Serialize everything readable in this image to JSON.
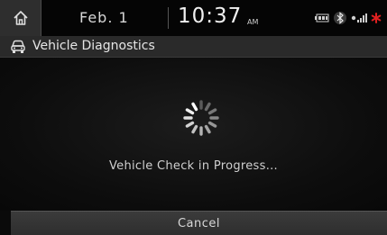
{
  "status_bar": {
    "date": "Feb. 1",
    "time": "10:37",
    "ampm": "AM",
    "icons": [
      "battery-icon",
      "bluetooth-icon",
      "signal-icon",
      "asterisk-icon"
    ],
    "accent_color": "#e02020"
  },
  "title_bar": {
    "icon": "car-icon",
    "title": "Vehicle Diagnostics"
  },
  "main": {
    "spinner_icon": "loading-spinner-icon",
    "message": "Vehicle Check in Progress..."
  },
  "footer": {
    "cancel_label": "Cancel"
  }
}
